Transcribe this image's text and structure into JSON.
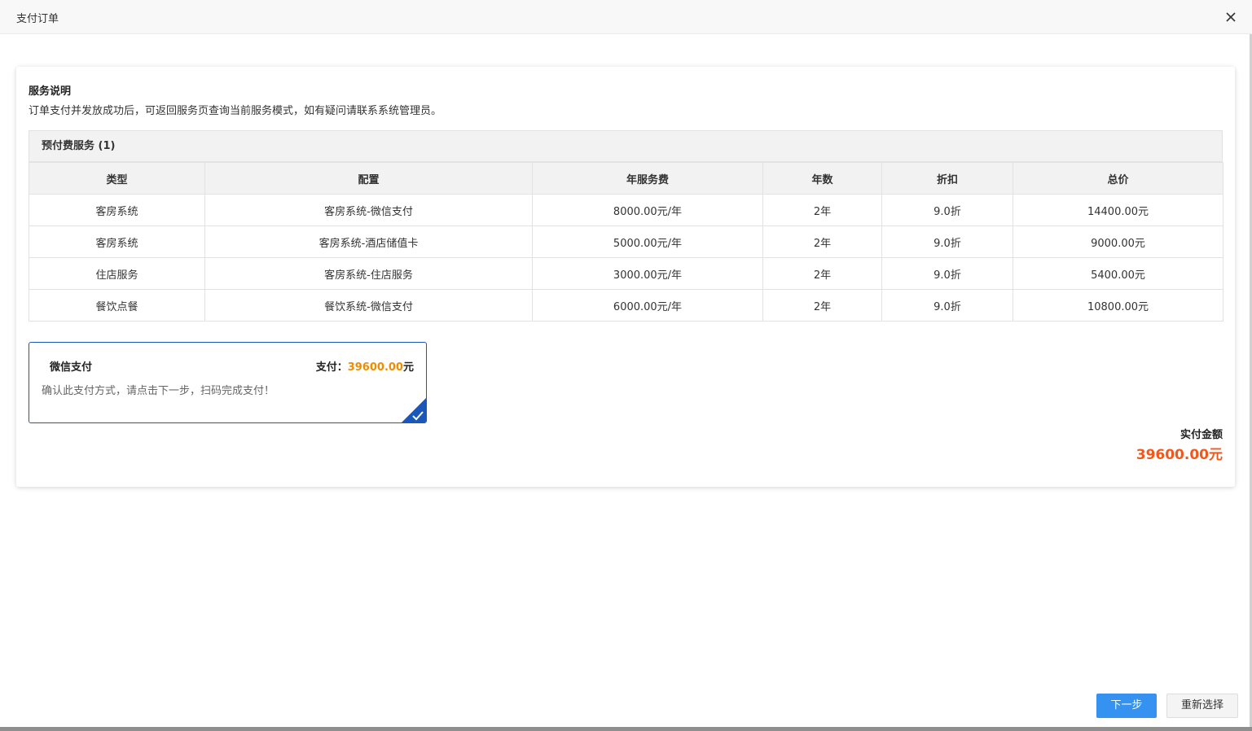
{
  "dialog": {
    "title": "支付订单"
  },
  "service": {
    "title": "服务说明",
    "description": "订单支付并发放成功后，可返回服务页查询当前服务模式，如有疑问请联系系统管理员。"
  },
  "order_table": {
    "group_title": "预付费服务 (1)",
    "columns": [
      "类型",
      "配置",
      "年服务费",
      "年数",
      "折扣",
      "总价"
    ],
    "rows": [
      [
        "客房系统",
        "客房系统-微信支付",
        "8000.00元/年",
        "2年",
        "9.0折",
        "14400.00元"
      ],
      [
        "客房系统",
        "客房系统-酒店储值卡",
        "5000.00元/年",
        "2年",
        "9.0折",
        "9000.00元"
      ],
      [
        "住店服务",
        "客房系统-住店服务",
        "3000.00元/年",
        "2年",
        "9.0折",
        "5400.00元"
      ],
      [
        "餐饮点餐",
        "餐饮系统-微信支付",
        "6000.00元/年",
        "2年",
        "9.0折",
        "10800.00元"
      ]
    ]
  },
  "payment": {
    "method_name": "微信支付",
    "pay_label": "支付：",
    "pay_amount": "39600.00",
    "pay_unit": "元",
    "tip": "确认此支付方式，请点击下一步，扫码完成支付！",
    "selected": true
  },
  "total": {
    "label": "实付金额",
    "value": "39600.00元"
  },
  "buttons": {
    "next_label": "下一步",
    "reset_label": "重新选择"
  },
  "colors": {
    "accent_blue": "#3592f0",
    "selected_border": "#1a57b8",
    "amount_orange": "#f08c00",
    "total_red": "#f0581c"
  },
  "icons": {
    "close": "close-icon",
    "selected": "checkmark-icon"
  }
}
